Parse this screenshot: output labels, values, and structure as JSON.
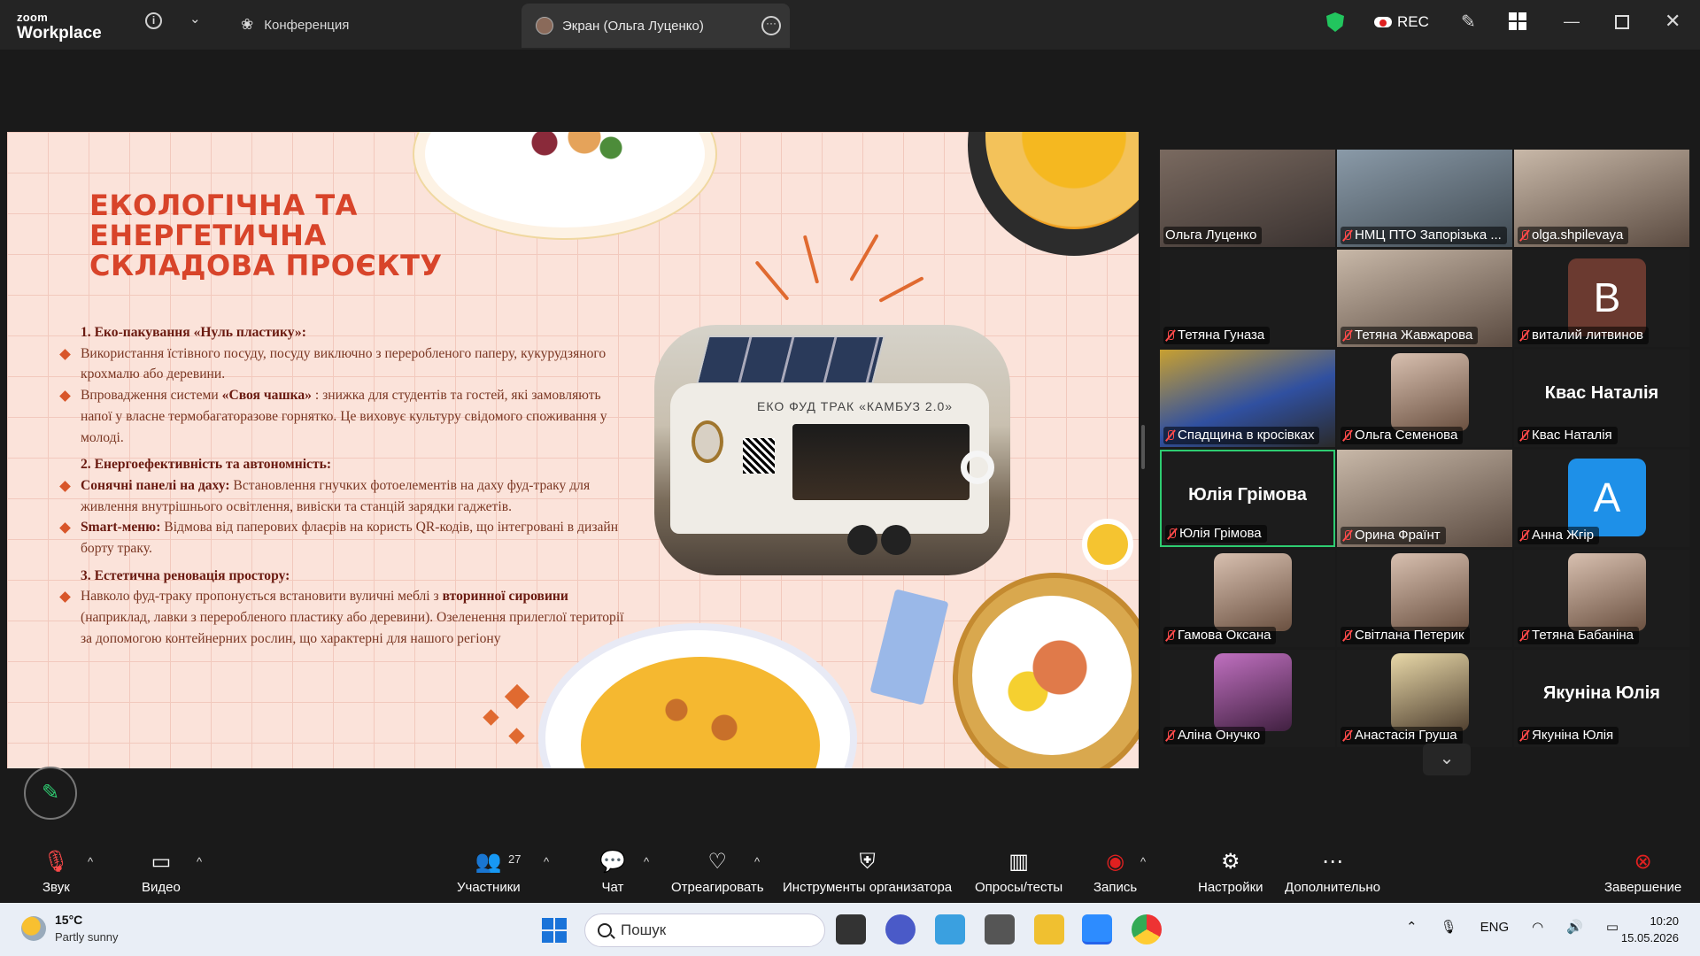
{
  "app": {
    "logo_small": "zoom",
    "logo_big": "Workplace"
  },
  "tabs": {
    "conference": "Конференция",
    "screen": "Экран (Ольга Луценко)"
  },
  "topbar": {
    "rec": "REC"
  },
  "slide": {
    "title": "ЕКОЛОГІЧНА ТА ЕНЕРГЕТИЧНА СКЛАДОВА ПРОЄКТУ",
    "s1_head": "1. Еко-пакування «Нуль пластику»:",
    "s1_p1": "Використання їстівного посуду, посуду виключно з переробленого паперу, кукурудзяного крохмалю або деревини.",
    "s1_p2a": "Впровадження системи ",
    "s1_p2b": "«Своя чашка»",
    "s1_p2c": " : знижка для студентів та гостей, які замовляють напої у власне термобагаторазове горнятко. Це виховує культуру свідомого споживання у молоді.",
    "s2_head": "2. Енергоефективність та автономність:",
    "s2_p1a": "Сонячні панелі на даху:",
    "s2_p1b": " Встановлення гнучких фотоелементів на даху фуд-траку для живлення внутрішнього освітлення, вивіски та станцій зарядки гаджетів.",
    "s2_p2a": "Smart-меню:",
    "s2_p2b": " Відмова від паперових флаєрів на користь QR-кодів, що інтегровані в дизайн борту траку.",
    "s3_head": "3. Естетична реновація простору:",
    "s3_p1a": "Навколо фуд-траку пропонується встановити вуличні меблі з ",
    "s3_p1b": "вторинної сировини",
    "s3_p1c": " (наприклад, лавки з переробленого пластику або деревини). Озеленення прилеглої території за допомогою контейнерних рослин, що характерні для нашого регіону",
    "truck_text": "ЕКО ФУД ТРАК    «КАМБУЗ 2.0»"
  },
  "participants": [
    {
      "name": "Ольга Луценко",
      "muted": false
    },
    {
      "name": "НМЦ ПТО Запорізька ...",
      "muted": true
    },
    {
      "name": "olga.shpilevaya",
      "muted": true
    },
    {
      "name": "Тетяна Гуназа",
      "muted": true
    },
    {
      "name": "Тетяна Жавжарова",
      "muted": true
    },
    {
      "name": "виталий литвинов",
      "muted": true,
      "letter": "В"
    },
    {
      "name": "Спадщина в кросівках",
      "muted": true
    },
    {
      "name": "Ольга Семенова",
      "muted": true
    },
    {
      "name": "Квас Наталія",
      "muted": true,
      "bigname": "Квас Наталія"
    },
    {
      "name": "Юлія Грімова",
      "muted": true,
      "bigname": "Юлія Грімова"
    },
    {
      "name": "Орина Фраїнт",
      "muted": true
    },
    {
      "name": "Анна Жгір",
      "muted": true,
      "letter": "A"
    },
    {
      "name": "Гамова Оксана",
      "muted": true
    },
    {
      "name": "Світлана Петерик",
      "muted": true
    },
    {
      "name": "Тетяна Бабаніна",
      "muted": true
    },
    {
      "name": "Аліна Онучко",
      "muted": true
    },
    {
      "name": "Анастасія Груша",
      "muted": true
    },
    {
      "name": "Якуніна Юлія",
      "muted": true,
      "bigname": "Якуніна Юлія"
    }
  ],
  "toolbar": {
    "audio": "Звук",
    "video": "Видео",
    "participants": "Участники",
    "participants_count": "27",
    "chat": "Чат",
    "react": "Отреагировать",
    "host_tools": "Инструменты организатора",
    "polls": "Опросы/тесты",
    "record": "Запись",
    "settings": "Настройки",
    "more": "Дополнительно",
    "end": "Завершение"
  },
  "taskbar": {
    "temp": "15°C",
    "weather": "Partly sunny",
    "search": "Пошук",
    "lang": "ENG",
    "time": "10:20",
    "date": "15.05.2026"
  },
  "colors": {
    "accent_green": "#2ecc71",
    "title_red": "#d8442a",
    "mute_red": "#ff4a4a"
  }
}
